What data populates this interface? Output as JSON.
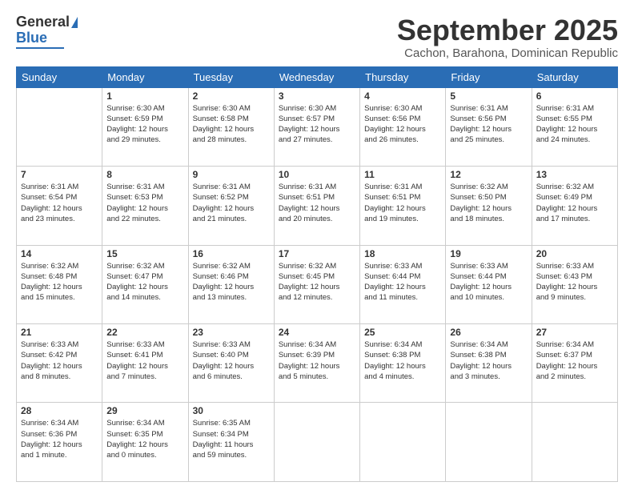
{
  "logo": {
    "general": "General",
    "blue": "Blue"
  },
  "header": {
    "title": "September 2025",
    "subtitle": "Cachon, Barahona, Dominican Republic"
  },
  "days_of_week": [
    "Sunday",
    "Monday",
    "Tuesday",
    "Wednesday",
    "Thursday",
    "Friday",
    "Saturday"
  ],
  "weeks": [
    [
      {
        "day": "",
        "info": ""
      },
      {
        "day": "1",
        "info": "Sunrise: 6:30 AM\nSunset: 6:59 PM\nDaylight: 12 hours\nand 29 minutes."
      },
      {
        "day": "2",
        "info": "Sunrise: 6:30 AM\nSunset: 6:58 PM\nDaylight: 12 hours\nand 28 minutes."
      },
      {
        "day": "3",
        "info": "Sunrise: 6:30 AM\nSunset: 6:57 PM\nDaylight: 12 hours\nand 27 minutes."
      },
      {
        "day": "4",
        "info": "Sunrise: 6:30 AM\nSunset: 6:56 PM\nDaylight: 12 hours\nand 26 minutes."
      },
      {
        "day": "5",
        "info": "Sunrise: 6:31 AM\nSunset: 6:56 PM\nDaylight: 12 hours\nand 25 minutes."
      },
      {
        "day": "6",
        "info": "Sunrise: 6:31 AM\nSunset: 6:55 PM\nDaylight: 12 hours\nand 24 minutes."
      }
    ],
    [
      {
        "day": "7",
        "info": "Sunrise: 6:31 AM\nSunset: 6:54 PM\nDaylight: 12 hours\nand 23 minutes."
      },
      {
        "day": "8",
        "info": "Sunrise: 6:31 AM\nSunset: 6:53 PM\nDaylight: 12 hours\nand 22 minutes."
      },
      {
        "day": "9",
        "info": "Sunrise: 6:31 AM\nSunset: 6:52 PM\nDaylight: 12 hours\nand 21 minutes."
      },
      {
        "day": "10",
        "info": "Sunrise: 6:31 AM\nSunset: 6:51 PM\nDaylight: 12 hours\nand 20 minutes."
      },
      {
        "day": "11",
        "info": "Sunrise: 6:31 AM\nSunset: 6:51 PM\nDaylight: 12 hours\nand 19 minutes."
      },
      {
        "day": "12",
        "info": "Sunrise: 6:32 AM\nSunset: 6:50 PM\nDaylight: 12 hours\nand 18 minutes."
      },
      {
        "day": "13",
        "info": "Sunrise: 6:32 AM\nSunset: 6:49 PM\nDaylight: 12 hours\nand 17 minutes."
      }
    ],
    [
      {
        "day": "14",
        "info": "Sunrise: 6:32 AM\nSunset: 6:48 PM\nDaylight: 12 hours\nand 15 minutes."
      },
      {
        "day": "15",
        "info": "Sunrise: 6:32 AM\nSunset: 6:47 PM\nDaylight: 12 hours\nand 14 minutes."
      },
      {
        "day": "16",
        "info": "Sunrise: 6:32 AM\nSunset: 6:46 PM\nDaylight: 12 hours\nand 13 minutes."
      },
      {
        "day": "17",
        "info": "Sunrise: 6:32 AM\nSunset: 6:45 PM\nDaylight: 12 hours\nand 12 minutes."
      },
      {
        "day": "18",
        "info": "Sunrise: 6:33 AM\nSunset: 6:44 PM\nDaylight: 12 hours\nand 11 minutes."
      },
      {
        "day": "19",
        "info": "Sunrise: 6:33 AM\nSunset: 6:44 PM\nDaylight: 12 hours\nand 10 minutes."
      },
      {
        "day": "20",
        "info": "Sunrise: 6:33 AM\nSunset: 6:43 PM\nDaylight: 12 hours\nand 9 minutes."
      }
    ],
    [
      {
        "day": "21",
        "info": "Sunrise: 6:33 AM\nSunset: 6:42 PM\nDaylight: 12 hours\nand 8 minutes."
      },
      {
        "day": "22",
        "info": "Sunrise: 6:33 AM\nSunset: 6:41 PM\nDaylight: 12 hours\nand 7 minutes."
      },
      {
        "day": "23",
        "info": "Sunrise: 6:33 AM\nSunset: 6:40 PM\nDaylight: 12 hours\nand 6 minutes."
      },
      {
        "day": "24",
        "info": "Sunrise: 6:34 AM\nSunset: 6:39 PM\nDaylight: 12 hours\nand 5 minutes."
      },
      {
        "day": "25",
        "info": "Sunrise: 6:34 AM\nSunset: 6:38 PM\nDaylight: 12 hours\nand 4 minutes."
      },
      {
        "day": "26",
        "info": "Sunrise: 6:34 AM\nSunset: 6:38 PM\nDaylight: 12 hours\nand 3 minutes."
      },
      {
        "day": "27",
        "info": "Sunrise: 6:34 AM\nSunset: 6:37 PM\nDaylight: 12 hours\nand 2 minutes."
      }
    ],
    [
      {
        "day": "28",
        "info": "Sunrise: 6:34 AM\nSunset: 6:36 PM\nDaylight: 12 hours\nand 1 minute."
      },
      {
        "day": "29",
        "info": "Sunrise: 6:34 AM\nSunset: 6:35 PM\nDaylight: 12 hours\nand 0 minutes."
      },
      {
        "day": "30",
        "info": "Sunrise: 6:35 AM\nSunset: 6:34 PM\nDaylight: 11 hours\nand 59 minutes."
      },
      {
        "day": "",
        "info": ""
      },
      {
        "day": "",
        "info": ""
      },
      {
        "day": "",
        "info": ""
      },
      {
        "day": "",
        "info": ""
      }
    ]
  ]
}
